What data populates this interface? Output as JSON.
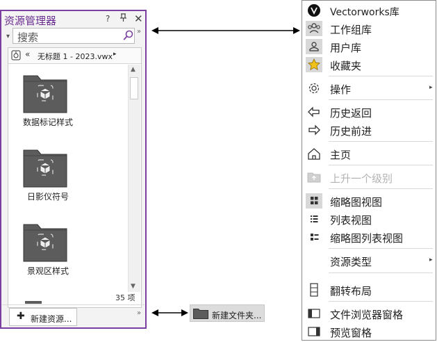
{
  "resource_manager": {
    "title": "资源管理器",
    "help": "?",
    "pin": "ᵽ",
    "close": "✕",
    "search_placeholder": "搜索",
    "more": "»",
    "file_name": "无标题 1 - 2023.vwx",
    "back": "«",
    "forward": "▸",
    "items": [
      {
        "label": "数据标记样式"
      },
      {
        "label": "日影仪符号"
      },
      {
        "label": "景观区样式"
      }
    ],
    "count": "35 项",
    "new_resource_label": "新建资源...",
    "new_resource_plus": "✚"
  },
  "hidden_button": {
    "label": "新建文件夹..."
  },
  "menu": {
    "vectorworks_library": "Vectorworks库",
    "workgroup_library": "工作组库",
    "user_library": "用户库",
    "favorites": "收藏夹",
    "actions": "操作",
    "history_back": "历史返回",
    "history_forward": "历史前进",
    "home": "主页",
    "up_one_level": "上升一个级别",
    "thumbnail_view": "缩略图视图",
    "list_view": "列表视图",
    "thumbnail_list_view": "缩略图列表视图",
    "resource_type": "资源类型",
    "flip_layout": "翻转布局",
    "file_browser_pane": "文件浏览器窗格",
    "preview_pane": "预览窗格",
    "submenu_arrow": "▸"
  },
  "colors": {
    "accent_purple": "#6a2c91",
    "folder_gray": "#5c5c5c",
    "star_yellow": "#f2c21b"
  }
}
